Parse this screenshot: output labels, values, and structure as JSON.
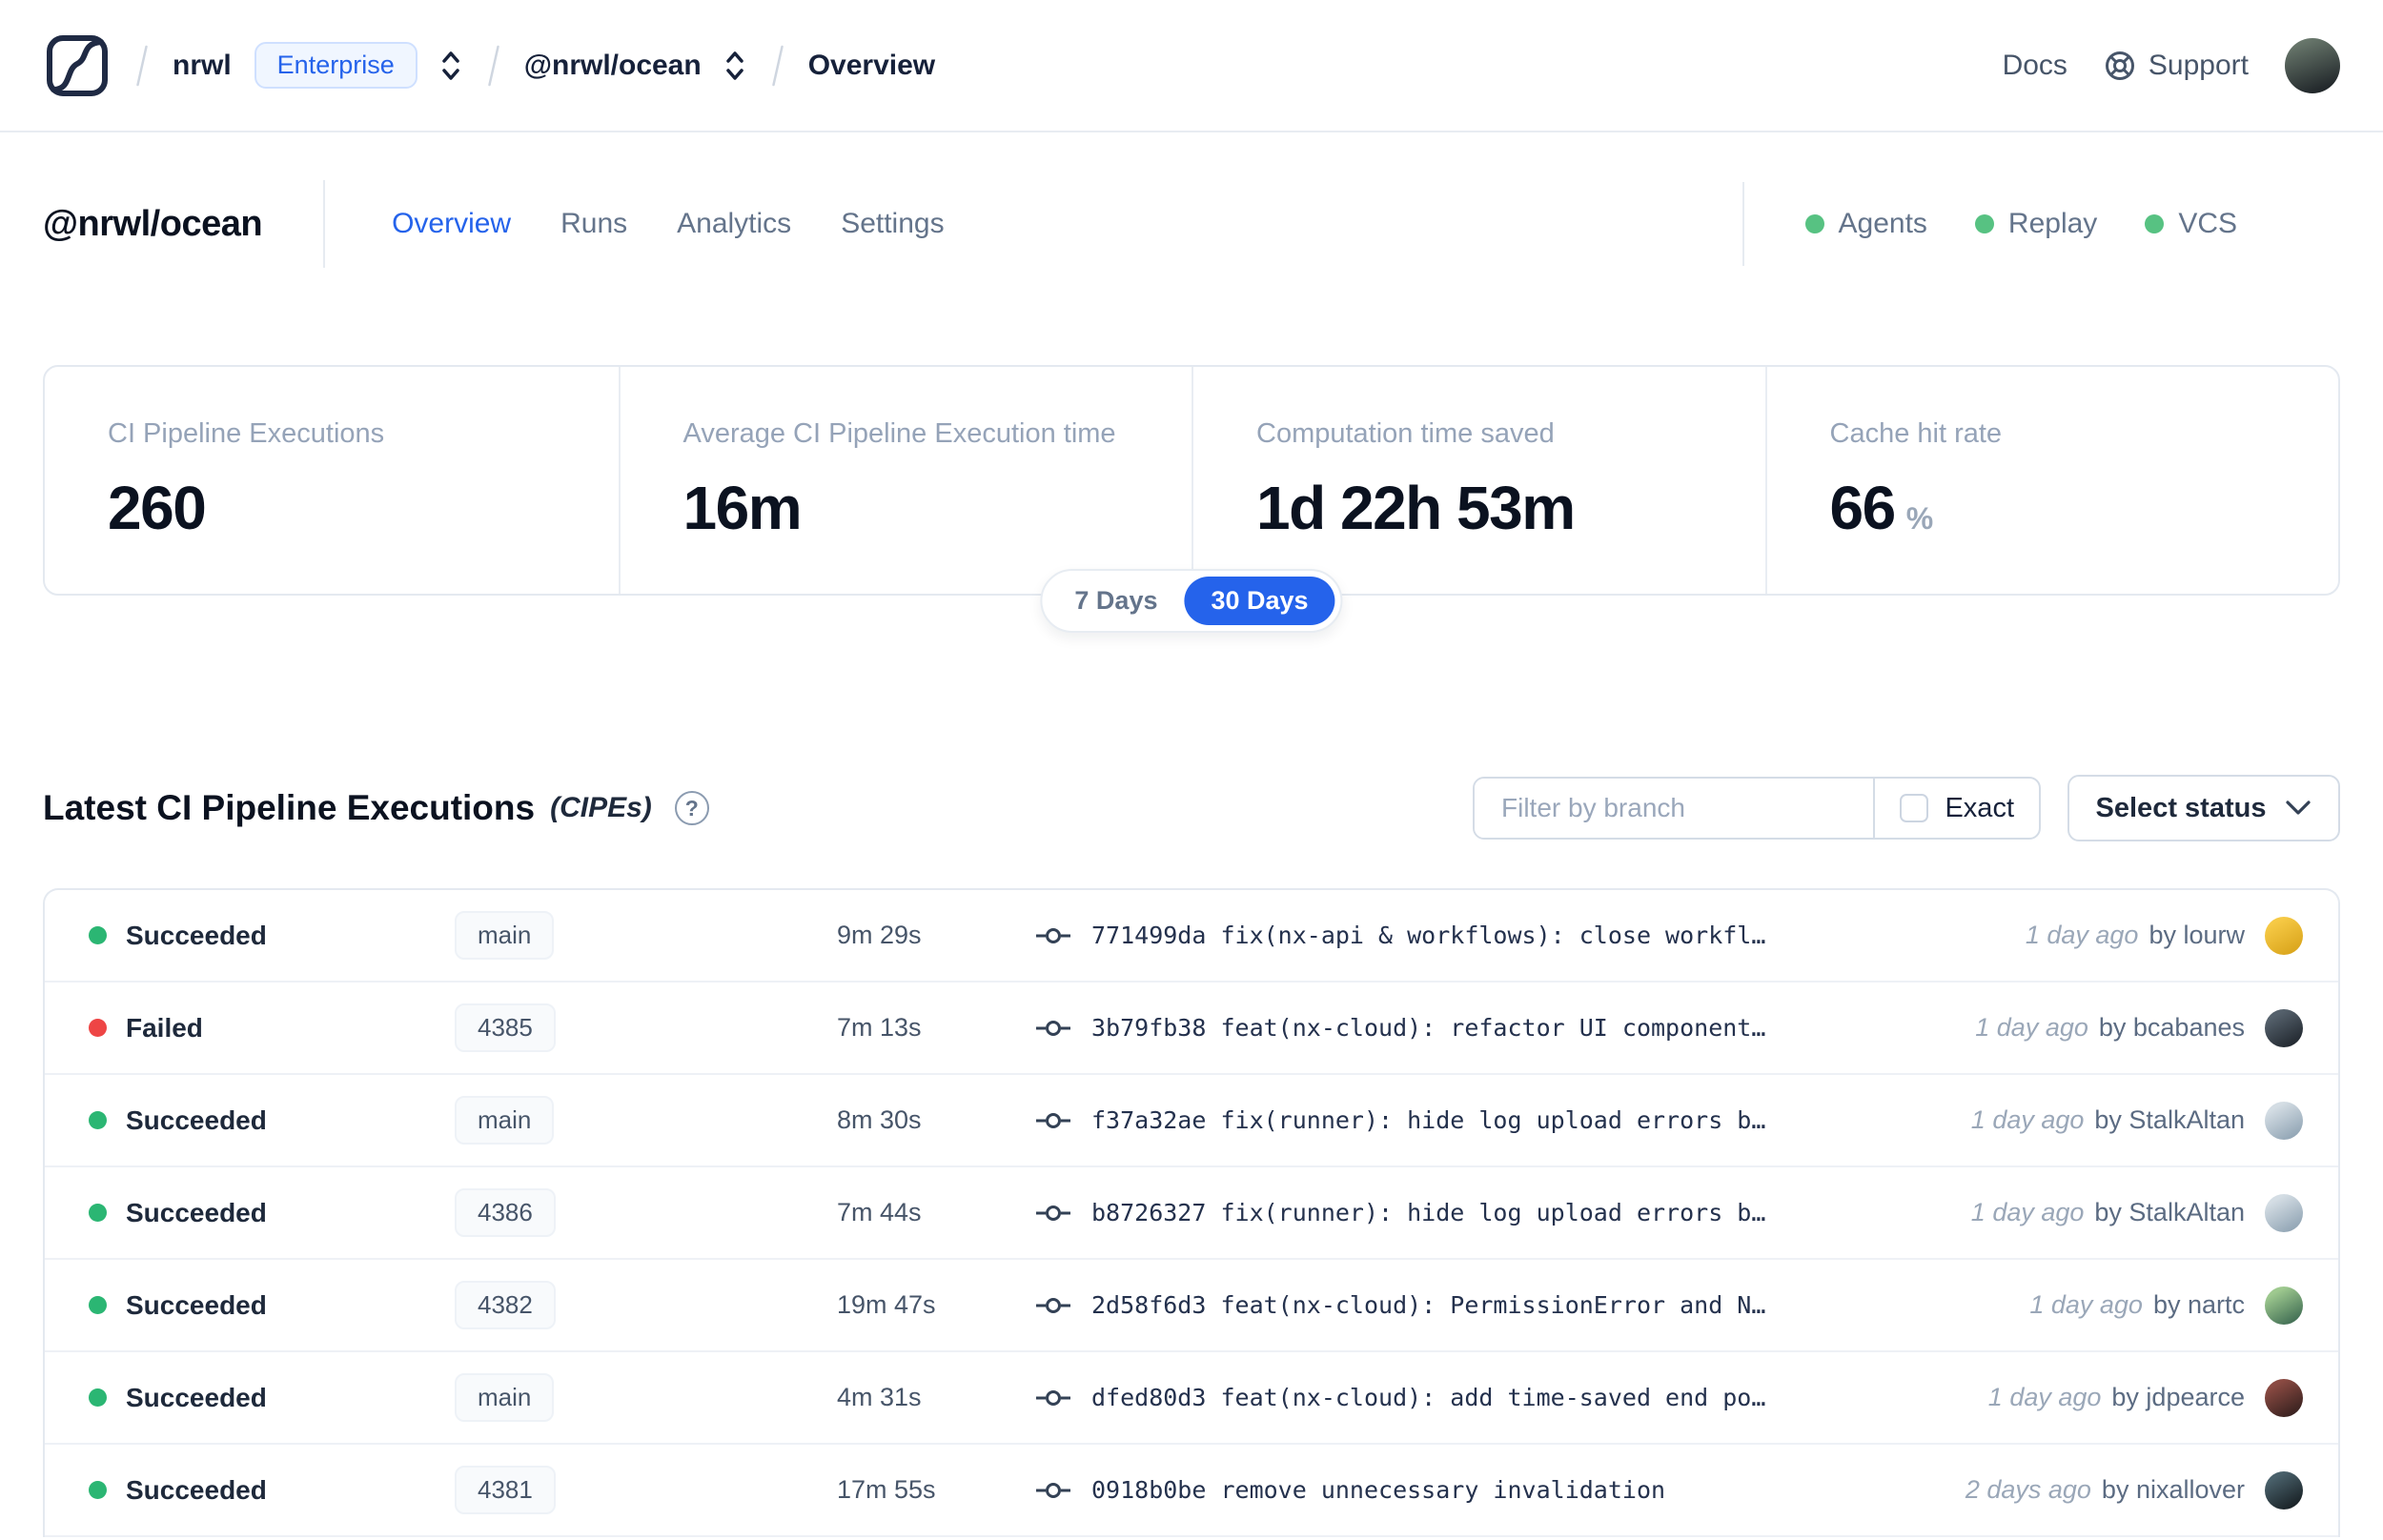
{
  "nav": {
    "breadcrumb": {
      "org": "nrwl",
      "badge": "Enterprise",
      "workspace": "@nrwl/ocean",
      "page": "Overview"
    },
    "links": {
      "docs": "Docs",
      "support": "Support"
    },
    "avatar": [
      "#6b7a6e",
      "#23292c"
    ]
  },
  "header": {
    "title": "@nrwl/ocean",
    "tabs": [
      {
        "label": "Overview",
        "active": true
      },
      {
        "label": "Runs",
        "active": false
      },
      {
        "label": "Analytics",
        "active": false
      },
      {
        "label": "Settings",
        "active": false
      }
    ],
    "status_pills": [
      {
        "label": "Agents"
      },
      {
        "label": "Replay"
      },
      {
        "label": "VCS"
      }
    ],
    "pill_dot_color": "#57c282"
  },
  "stats": {
    "cards": [
      {
        "label": "CI Pipeline Executions",
        "value": "260",
        "suffix": ""
      },
      {
        "label": "Average CI Pipeline Execution time",
        "value": "16m",
        "suffix": ""
      },
      {
        "label": "Computation time saved",
        "value": "1d 22h 53m",
        "suffix": ""
      },
      {
        "label": "Cache hit rate",
        "value": "66",
        "suffix": "%"
      }
    ],
    "range_toggle": {
      "options": [
        "7 Days",
        "30 Days"
      ],
      "selected": "30 Days",
      "active_color": "#2563eb"
    }
  },
  "cipe": {
    "title": "Latest CI Pipeline Executions",
    "title_suffix": "(CIPEs)",
    "help_icon_glyph": "?",
    "filter": {
      "placeholder": "Filter by branch",
      "exact_label": "Exact",
      "status_label": "Select status"
    },
    "status_colors": {
      "succeeded": "#2bb673",
      "failed": "#ee4545"
    },
    "rows": [
      {
        "status": "Succeeded",
        "branch": "main",
        "duration": "9m 29s",
        "commit": "771499da fix(nx-api & workflows): close workfl…",
        "time": "1 day ago",
        "author": "by lourw",
        "avatar": [
          "#f6c945",
          "#d9a41b"
        ]
      },
      {
        "status": "Failed",
        "branch": "4385",
        "duration": "7m 13s",
        "commit": "3b79fb38 feat(nx-cloud): refactor UI component…",
        "time": "1 day ago",
        "author": "by bcabanes",
        "avatar": [
          "#55616c",
          "#20262d"
        ]
      },
      {
        "status": "Succeeded",
        "branch": "main",
        "duration": "8m 30s",
        "commit": "f37a32ae fix(runner): hide log upload errors b…",
        "time": "1 day ago",
        "author": "by StalkAltan",
        "avatar": [
          "#d4dde4",
          "#8fa3b3"
        ]
      },
      {
        "status": "Succeeded",
        "branch": "4386",
        "duration": "7m 44s",
        "commit": "b8726327 fix(runner): hide log upload errors b…",
        "time": "1 day ago",
        "author": "by StalkAltan",
        "avatar": [
          "#d4dde4",
          "#8fa3b3"
        ]
      },
      {
        "status": "Succeeded",
        "branch": "4382",
        "duration": "19m 47s",
        "commit": "2d58f6d3 feat(nx-cloud): PermissionError and N…",
        "time": "1 day ago",
        "author": "by nartc",
        "avatar": [
          "#9ec98f",
          "#3e6b52"
        ]
      },
      {
        "status": "Succeeded",
        "branch": "main",
        "duration": "4m 31s",
        "commit": "dfed80d3 feat(nx-cloud): add time-saved end po…",
        "time": "1 day ago",
        "author": "by jdpearce",
        "avatar": [
          "#8a4a42",
          "#35201e"
        ]
      },
      {
        "status": "Succeeded",
        "branch": "4381",
        "duration": "17m 55s",
        "commit": "0918b0be remove unnecessary invalidation",
        "time": "2 days ago",
        "author": "by nixallover",
        "avatar": [
          "#49606a",
          "#171f23"
        ]
      }
    ]
  }
}
